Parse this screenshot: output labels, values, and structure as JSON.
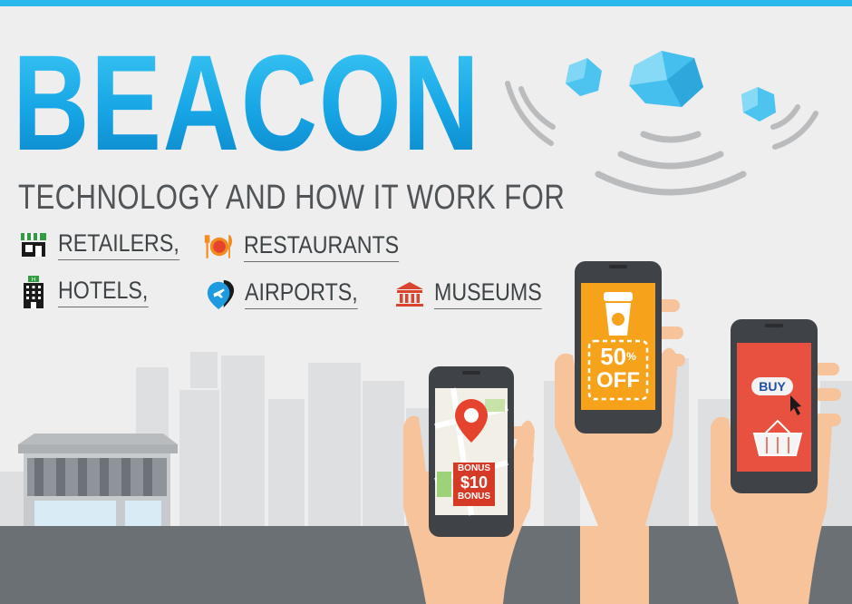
{
  "header": {
    "title": "BEACON",
    "subtitle": "TECHNOLOGY AND HOW IT WORK FOR"
  },
  "targets": [
    {
      "label": "RETAILERS,",
      "icon": "store-icon"
    },
    {
      "label": "RESTAURANTS",
      "icon": "restaurant-icon"
    },
    {
      "label": "HOTELS,",
      "icon": "hotel-icon"
    },
    {
      "label": "AIRPORTS,",
      "icon": "airport-icon"
    },
    {
      "label": "MUSEUMS",
      "icon": "museum-icon"
    }
  ],
  "phones": {
    "left": {
      "badge_line1": "BONUS",
      "badge_amount": "$10",
      "badge_line2": "BONUS"
    },
    "middle": {
      "discount": "50",
      "percent": "%",
      "off": "OFF"
    },
    "right": {
      "button": "BUY"
    }
  },
  "colors": {
    "accent": "#29b9ec",
    "title_top": "#3dc8f4",
    "title_bottom": "#0b86c9",
    "text": "#505456",
    "ground": "#6b7075",
    "coupon_orange": "#f7a21b",
    "buy_red": "#e8513f",
    "map_pin": "#e5432e"
  }
}
